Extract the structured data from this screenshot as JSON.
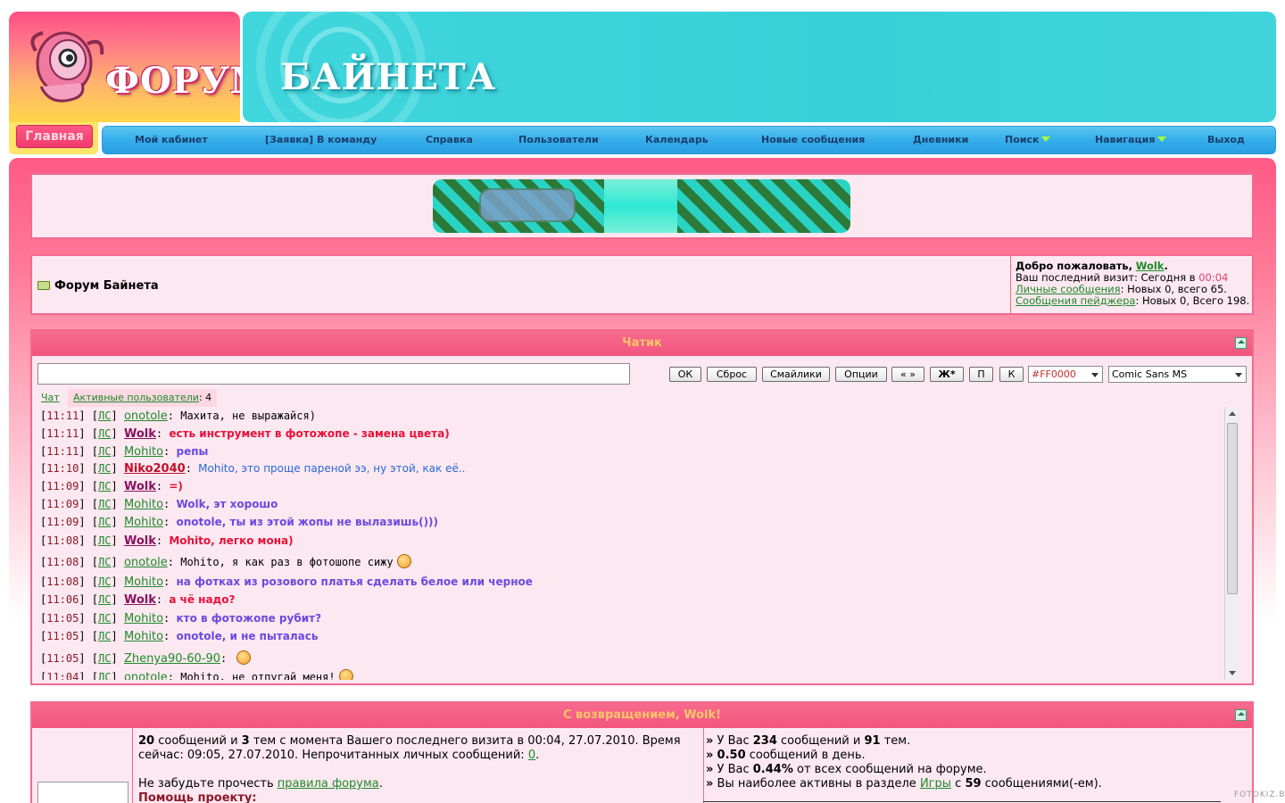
{
  "header": {
    "logo_text": "ФОРУМ",
    "banner_text": "БАЙНЕТА",
    "home_button": "Главная"
  },
  "nav": {
    "items": [
      {
        "label": "Мой кабинет"
      },
      {
        "label": "[Заявка] В команду"
      },
      {
        "label": "Справка"
      },
      {
        "label": "Пользователи"
      },
      {
        "label": "Календарь"
      },
      {
        "label": "Новые сообщения"
      },
      {
        "label": "Дневники"
      },
      {
        "label": "Поиск"
      },
      {
        "label": "Навигация"
      },
      {
        "label": "Выход"
      }
    ]
  },
  "breadcrumb": {
    "title": "Форум Байнета"
  },
  "welcome": {
    "greeting": "Добро пожаловать,",
    "username": "Wolk",
    "last_visit_label": "Ваш последний визит: Сегодня в",
    "last_visit_time": "00:04",
    "pm_link": "Личные сообщения",
    "pm_stats": ": Новых 0, всего 65.",
    "pager_link": "Сообщения пейджера",
    "pager_stats": ": Новых 0, Всего 198."
  },
  "chat": {
    "title": "Чатик",
    "buttons": {
      "ok": "ОК",
      "reset": "Сброс",
      "smileys": "Смайлики",
      "options": "Опции",
      "quotes": "« »",
      "bold": "Ж*",
      "p": "П",
      "k": "К"
    },
    "color_value": "#FF0000",
    "font_value": "Comic Sans MS",
    "tab_chat": "Чат",
    "tab_active_label": "Активные пользователи",
    "tab_active_count": ": 4",
    "pm_tag": "ЛС",
    "messages": [
      {
        "time": "11:11",
        "user": "onotole",
        "text": "Махита, не выражайся)",
        "color": "#000000",
        "ucolor": "#1e8a2a"
      },
      {
        "time": "11:11",
        "user": "Wolk",
        "text": "есть инструмент в фотожопе - замена цвета)",
        "color": "#e8103a",
        "ucolor": "#8a1060"
      },
      {
        "time": "11:11",
        "user": "Mohito",
        "text": "репы",
        "color": "#6a4ae0",
        "ucolor": "#1e8a2a"
      },
      {
        "time": "11:10",
        "user": "Niko2040",
        "text": "Mohito, это проще пареной ээ, ну этой, как её..",
        "color": "#2a6ad8",
        "ucolor": "#c0102a"
      },
      {
        "time": "11:09",
        "user": "Wolk",
        "text": "=)",
        "color": "#e8103a",
        "ucolor": "#8a1060"
      },
      {
        "time": "11:09",
        "user": "Mohito",
        "text": "Wolk, эт хорошо",
        "color": "#6a4ae0",
        "ucolor": "#1e8a2a"
      },
      {
        "time": "11:09",
        "user": "Mohito",
        "text": "onotole, ты из этой жопы не вылазишь()))",
        "color": "#6a4ae0",
        "ucolor": "#1e8a2a"
      },
      {
        "time": "11:08",
        "user": "Wolk",
        "text": "Mohito, легко мона)",
        "color": "#e8103a",
        "ucolor": "#8a1060"
      },
      {
        "time": "11:08",
        "user": "onotole",
        "text": "Mohito, я как раз в фотошопе сижу",
        "color": "#000000",
        "ucolor": "#1e8a2a"
      },
      {
        "time": "11:08",
        "user": "Mohito",
        "text": "на фотках из розового платья сделать белое или черное",
        "color": "#6a4ae0",
        "ucolor": "#1e8a2a"
      },
      {
        "time": "11:06",
        "user": "Wolk",
        "text": "а чё надо?",
        "color": "#e8103a",
        "ucolor": "#8a1060"
      },
      {
        "time": "11:05",
        "user": "Mohito",
        "text": "кто в фотожопе рубит?",
        "color": "#6a4ae0",
        "ucolor": "#1e8a2a"
      },
      {
        "time": "11:05",
        "user": "Mohito",
        "text": "onotole, и не пыталась",
        "color": "#6a4ae0",
        "ucolor": "#1e8a2a"
      },
      {
        "time": "11:05",
        "user": "Zhenya90-60-90",
        "text": "",
        "color": "#000000",
        "ucolor": "#1e8a2a"
      },
      {
        "time": "11:04",
        "user": "onotole",
        "text": "Mohito, не отпугай меня!",
        "color": "#000000",
        "ucolor": "#1e8a2a"
      }
    ]
  },
  "welcome_back": {
    "title": "С возвращением, Wolk!",
    "left": {
      "posts": "20",
      "p1": " сообщений и ",
      "topics": "3",
      "p2": " тем с момента Вашего последнего визита в 00:04, 27.07.2010. Время сейчас: 09:05, 27.07.2010. Непрочитанных личных сообщений: ",
      "unread": "0",
      "p3": ".",
      "rules_pre": "Не забудьте прочесть ",
      "rules_link": "правила форума",
      "rules_post": ".",
      "help": "Помощь проекту:"
    },
    "right": {
      "l1a": "У Вас ",
      "l1b": "234",
      "l1c": " сообщений и ",
      "l1d": "91",
      "l1e": " тем.",
      "l2a": "0.50",
      "l2b": " сообщений в день.",
      "l3a": "У Вас ",
      "l3b": "0.44%",
      "l3c": " от всех сообщений на форуме.",
      "l4a": "Вы наиболее активны в разделе ",
      "l4b": "Игры",
      "l4c": " с ",
      "l4d": "59",
      "l4e": " сообщениями(-ем)."
    }
  },
  "credit": "FOTOKIZ.BY"
}
